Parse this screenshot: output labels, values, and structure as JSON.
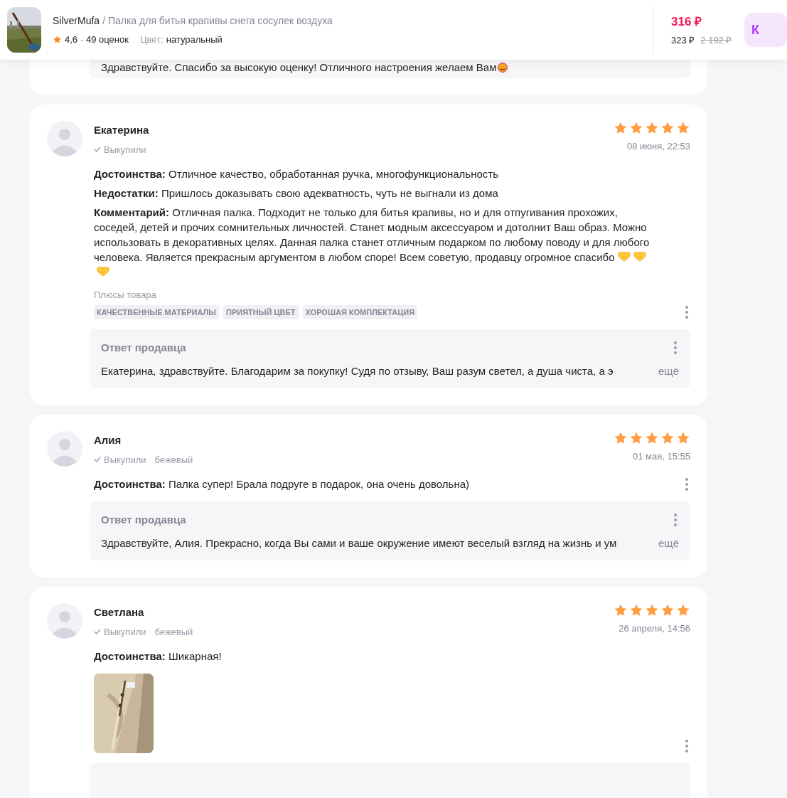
{
  "header": {
    "seller": "SilverMufa",
    "title": "/ Палка для битья крапивы снега сосулек воздуха",
    "rating": "4,6",
    "reviews_count": "· 49 оценок",
    "color_label": "Цвет:",
    "color_value": "натуральный",
    "price": "316 ₽",
    "price_card": "323 ₽",
    "price_old": "2 192 ₽",
    "button": "К"
  },
  "previous_reply": {
    "text": "Здравствуйте. Спасибо за высокую оценку! Отличного настроения желаем Вам"
  },
  "reviews": [
    {
      "name": "Екатерина",
      "bought": "Выкупили",
      "stars": 5,
      "date": "08 июня, 22:53",
      "sections": [
        {
          "label": "Достоинства:",
          "text": "Отличное качество, обработанная ручка, многофункциональность"
        },
        {
          "label": "Недостатки:",
          "text": "Пришлось доказывать свою адекватность, чуть не выгнали из дома"
        },
        {
          "label": "Комментарий:",
          "text": "Отличная палка. Подходит не только для битья крапивы, но и для отпугивания прохожих, соседей, детей и прочих сомнительных личностей. Станет модным аксессуаром и дотолнит Ваш образ. Можно использовать в декоративных целях. Данная палка станет отличным подарком по любому поводу и для любого человека. Является прекрасным аргументом в любом споре! Всем советую, продавцу огромное спасибо",
          "emojis": [
            {
              "kind": "heart-hands"
            },
            {
              "kind": "heart-hands"
            },
            {
              "kind": "heart-hands"
            }
          ]
        }
      ],
      "pros_title": "Плюсы товара",
      "tags": [
        "КАЧЕСТВЕННЫЕ МАТЕРИАЛЫ",
        "ПРИЯТНЫЙ ЦВЕТ",
        "ХОРОШАЯ КОМПЛЕКТАЦИЯ"
      ],
      "reply": {
        "kind": "full",
        "title": "Ответ продавца",
        "text": "Екатерина, здравствуйте. Благодарим за покупку! Судя по отзыву, Ваш разум светел, а душа чиста, а э",
        "more": "ещё"
      }
    },
    {
      "name": "Алия",
      "bought": "Выкупили",
      "variant": "бежевый",
      "stars": 5,
      "date": "01 мая, 15:55",
      "sections": [
        {
          "label": "Достоинства:",
          "text": "Палка супер! Брала подруге в подарок, она очень довольна)"
        }
      ],
      "reply": {
        "kind": "full",
        "title": "Ответ продавца",
        "text": "Здравствуйте, Алия. Прекрасно, когда Вы сами и ваше окружение имеют веселый взгляд на жизнь и ум",
        "more": "ещё"
      }
    },
    {
      "name": "Светлана",
      "bought": "Выкупили",
      "variant": "бежевый",
      "stars": 5,
      "date": "26 апреля, 14:56",
      "sections": [
        {
          "label": "Достоинства:",
          "text": "Шикарная!"
        }
      ],
      "photos": [
        {
          "kind": "picture"
        }
      ],
      "reply": {
        "kind": "cut"
      }
    }
  ]
}
